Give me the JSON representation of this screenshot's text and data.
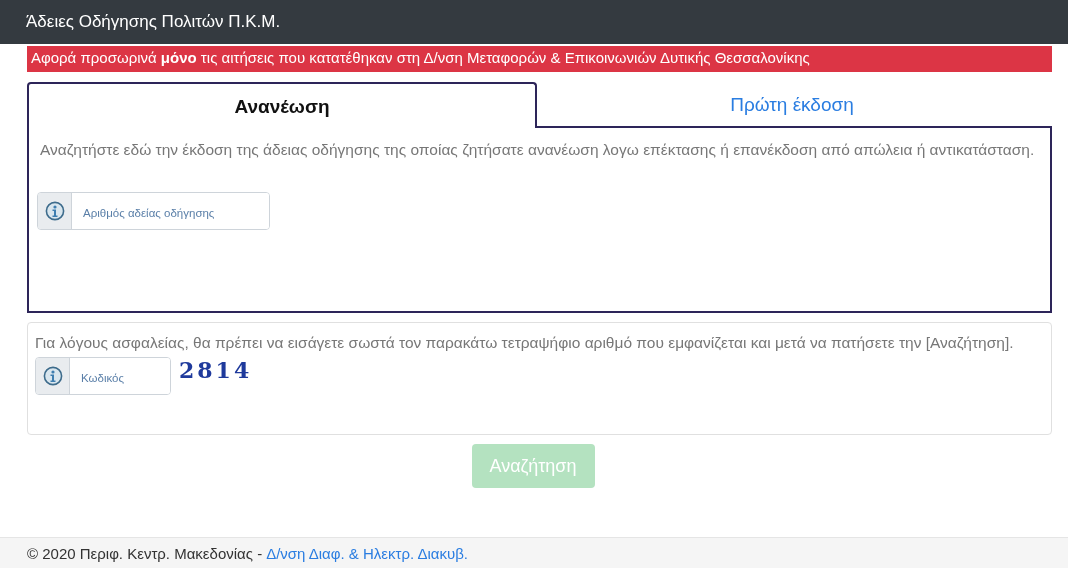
{
  "header": {
    "title": "Άδειες Οδήγησης Πολιτών Π.Κ.Μ."
  },
  "alert": {
    "text": "Αφορά προσωρινά **μόνο** τις αιτήσεις που κατατέθηκαν στη Δ/νση Μεταφορών & Επικοινωνιών Δυτικής Θεσσαλονίκης"
  },
  "tabs": [
    {
      "label": "Ανανέωση",
      "selected": true
    },
    {
      "label": "Πρώτη έκδοση",
      "selected": false
    }
  ],
  "tab_panel": {
    "description": "Αναζητήστε εδώ την έκδοση της άδειας οδήγησης της οποίας ζητήσατε ανανέωση λογω επέκτασης ή επανέκδοση από απώλεια ή αντικατάσταση.",
    "field": {
      "placeholder": "Αριθμός αδείας οδήγησης"
    }
  },
  "captcha": {
    "description": "Για λόγους ασφαλείας, θα πρέπει να εισάγετε σωστά τον παρακάτω τετραψήφιο αριθμό που εμφανίζεται και μετά να πατήσετε την [Αναζήτηση].",
    "field": {
      "placeholder": "Κωδικός"
    },
    "code": "2814"
  },
  "search_button": {
    "label": "Αναζήτηση",
    "disabled": true
  },
  "footer": {
    "text": "© 2020 Περιφ. Κεντρ. Μακεδονίας -",
    "link": "Δ/νση Διαφ. & Ηλεκτρ. Διακυβ."
  }
}
